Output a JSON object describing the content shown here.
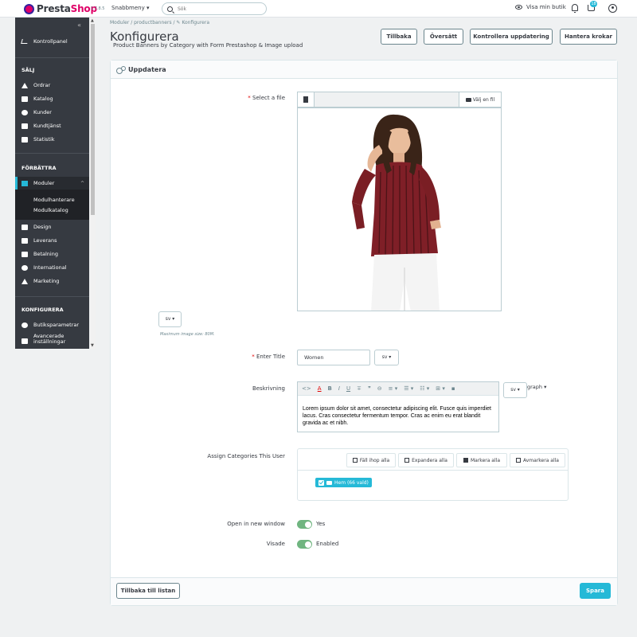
{
  "topbar": {
    "logo_prefix": "Presta",
    "logo_suffix": "Shop",
    "version": "1.7.8.5",
    "quick_access": "Snabbmeny ▾",
    "search_placeholder": "Sök",
    "view_shop": "Visa min butik",
    "notification_count": "18"
  },
  "sidebar": {
    "collapse": "«",
    "dashboard": "Kontrollpanel",
    "section_sell": "SÄLJ",
    "sell_items": [
      "Ordrar",
      "Katalog",
      "Kunder",
      "Kundtjänst",
      "Statistik"
    ],
    "section_improve": "FÖRBÄTTRA",
    "modules": "Moduler",
    "modules_sub": [
      "Modulhanterare",
      "Modulkatalog"
    ],
    "improve_items": [
      "Design",
      "Leverans",
      "Betalning",
      "International",
      "Marketing"
    ],
    "section_configure": "KONFIGURERA",
    "configure_items": [
      "Butiksparametrar",
      "Avancerade",
      "inställningar"
    ]
  },
  "header": {
    "breadcrumb": "Moduler  /  productbanners  /  ✎ Konfigurera",
    "title": "Konfigurera",
    "subtitle": "Product Banners by Category with Form Prestashop & Image upload",
    "buttons": [
      "Tillbaka",
      "Översätt",
      "Kontrollera uppdatering",
      "Hantera krokar"
    ]
  },
  "panel": {
    "heading": "Uppdatera",
    "file_label": "Select a file",
    "choose_file": "Välj en fil",
    "lang": "sv ▾",
    "hint": "Maximum image size: 80M.",
    "title_label": "Enter Title",
    "title_value": "Women",
    "description_label": "Beskrivning",
    "toolbar_icons": [
      "<>",
      "A",
      "B",
      "I",
      "U",
      "∓",
      "❞",
      "⊖",
      "≡ ▾",
      "☰ ▾",
      "☷ ▾",
      "⊞ ▾",
      "▪"
    ],
    "paragraph": "graph ▾",
    "description_text": "Lorem ipsum dolor sit amet, consectetur adipiscing elit. Fusce quis imperdiet lacus. Cras consectetur fermentum tempor. Cras ac enim eu erat blandit gravida ac et nibh.",
    "categories_label": "Assign Categories This User",
    "tree_buttons": [
      "Fäll ihop alla",
      "Expandera alla",
      "Markera alla",
      "Avmarkera alla"
    ],
    "tree_node": "Hem (66 vald)",
    "new_window_label": "Open in new window",
    "new_window_value": "Yes",
    "shown_label": "Visade",
    "shown_value": "Enabled",
    "back_to_list": "Tillbaka till listan",
    "save": "Spara"
  },
  "colors": {
    "accent": "#25b9d7",
    "sidebar": "#363a41",
    "toggle_on": "#70b580",
    "brand": "#df0067"
  }
}
